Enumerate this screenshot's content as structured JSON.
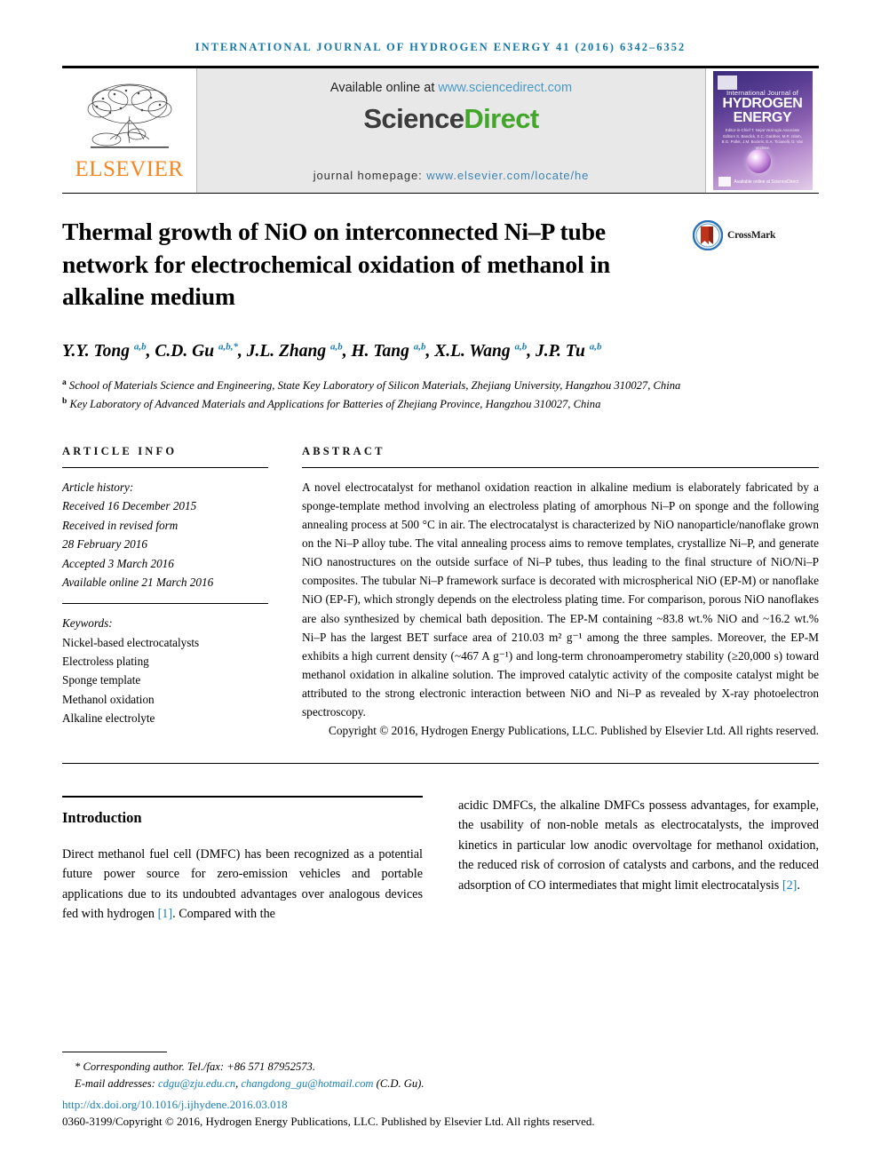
{
  "running_head": "INTERNATIONAL JOURNAL OF HYDROGEN ENERGY 41 (2016) 6342–6352",
  "masthead": {
    "publisher_name": "ELSEVIER",
    "publisher_logo_icon": "elsevier-tree-icon",
    "available_prefix": "Available online at ",
    "available_url": "www.sciencedirect.com",
    "sciencedirect_part1": "Science",
    "sciencedirect_part2": "Direct",
    "journal_home_label": "journal homepage: ",
    "journal_home_url": "www.elsevier.com/locate/he",
    "cover": {
      "line1": "International Journal of",
      "line2": "HYDROGEN",
      "line3": "ENERGY",
      "editors_block": "Editor-in-Chief  T. Nejat Veziroglu\nAssociate Editors  S. Bandick, E.C. Gardner, M.R. Islam,\nB.G. Pollet, J.M. Bockris,\nE.A. Ticianelli, D. Van Vechten",
      "footer_text": "Available online at ScienceDirect"
    }
  },
  "article": {
    "title": "Thermal growth of NiO on interconnected Ni–P tube network for electrochemical oxidation of methanol in alkaline medium",
    "crossmark_label": "CrossMark",
    "crossmark_icon": "crossmark-badge-icon",
    "authors": [
      {
        "name": "Y.Y. Tong",
        "marks": "a,b",
        "corresponding": false
      },
      {
        "name": "C.D. Gu",
        "marks": "a,b",
        "corresponding": true
      },
      {
        "name": "J.L. Zhang",
        "marks": "a,b",
        "corresponding": false
      },
      {
        "name": "H. Tang",
        "marks": "a,b",
        "corresponding": false
      },
      {
        "name": "X.L. Wang",
        "marks": "a,b",
        "corresponding": false
      },
      {
        "name": "J.P. Tu",
        "marks": "a,b",
        "corresponding": false
      }
    ],
    "affiliations": [
      {
        "mark": "a",
        "text": "School of Materials Science and Engineering, State Key Laboratory of Silicon Materials, Zhejiang University, Hangzhou 310027, China"
      },
      {
        "mark": "b",
        "text": "Key Laboratory of Advanced Materials and Applications for Batteries of Zhejiang Province, Hangzhou 310027, China"
      }
    ]
  },
  "article_info": {
    "heading": "ARTICLE INFO",
    "history_label": "Article history:",
    "history": [
      "Received 16 December 2015",
      "Received in revised form",
      "28 February 2016",
      "Accepted 3 March 2016",
      "Available online 21 March 2016"
    ],
    "keywords_label": "Keywords:",
    "keywords": [
      "Nickel-based electrocatalysts",
      "Electroless plating",
      "Sponge template",
      "Methanol oxidation",
      "Alkaline electrolyte"
    ]
  },
  "abstract": {
    "heading": "ABSTRACT",
    "text": "A novel electrocatalyst for methanol oxidation reaction in alkaline medium is elaborately fabricated by a sponge-template method involving an electroless plating of amorphous Ni–P on sponge and the following annealing process at 500 °C in air. The electrocatalyst is characterized by NiO nanoparticle/nanoflake grown on the Ni–P alloy tube. The vital annealing process aims to remove templates, crystallize Ni–P, and generate NiO nanostructures on the outside surface of Ni–P tubes, thus leading to the final structure of NiO/Ni–P composites. The tubular Ni–P framework surface is decorated with microspherical NiO (EP-M) or nanoflake NiO (EP-F), which strongly depends on the electroless plating time. For comparison, porous NiO nanoflakes are also synthesized by chemical bath deposition. The EP-M containing ~83.8 wt.% NiO and ~16.2 wt.% Ni–P has the largest BET surface area of 210.03 m² g⁻¹ among the three samples. Moreover, the EP-M exhibits a high current density (~467 A g⁻¹) and long-term chronoamperometry stability (≥20,000 s) toward methanol oxidation in alkaline solution. The improved catalytic activity of the composite catalyst might be attributed to the strong electronic interaction between NiO and Ni–P as revealed by X-ray photoelectron spectroscopy.",
    "copyright": "Copyright © 2016, Hydrogen Energy Publications, LLC. Published by Elsevier Ltd. All rights reserved."
  },
  "body": {
    "section_heading": "Introduction",
    "left_paragraph_part1": "Direct methanol fuel cell (DMFC) has been recognized as a potential future power source for zero-emission vehicles and portable applications due to its undoubted advantages over analogous devices fed with hydrogen ",
    "left_ref": "[1]",
    "left_paragraph_part2": ". Compared with the",
    "right_paragraph_part1": "acidic DMFCs, the alkaline DMFCs possess advantages, for example, the usability of non-noble metals as electrocatalysts, the improved kinetics in particular low anodic overvoltage for methanol oxidation, the reduced risk of corrosion of catalysts and carbons, and the reduced adsorption of CO intermediates that might limit electrocatalysis ",
    "right_ref": "[2]",
    "right_paragraph_part2": "."
  },
  "footer": {
    "corresponding_note": "Corresponding author. Tel./fax: +86 571 87952573.",
    "email_label": "E-mail addresses: ",
    "email1": "cdgu@zju.edu.cn",
    "email_sep": ", ",
    "email2": "changdong_gu@hotmail.com",
    "email_suffix": " (C.D. Gu).",
    "doi": "http://dx.doi.org/10.1016/j.ijhydene.2016.03.018",
    "issn_line": "0360-3199/Copyright © 2016, Hydrogen Energy Publications, LLC. Published by Elsevier Ltd. All rights reserved."
  },
  "colors": {
    "running_head": "#1477a8",
    "link_blue": "#4a9ac8",
    "ref_blue": "#1a7fb5",
    "elsevier_orange": "#f5861f",
    "sciencedirect_green": "#41a62a",
    "banner_gray": "#e8e8e8"
  }
}
